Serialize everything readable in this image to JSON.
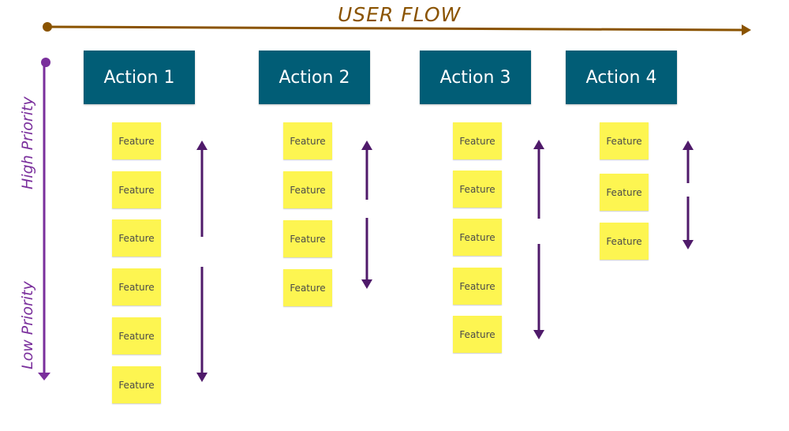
{
  "flow_axis": {
    "label": "USER FLOW",
    "color": "#8a5300"
  },
  "priority_axis": {
    "high_label": "High Priority",
    "low_label": "Low Priority",
    "color": "#7a2f9c"
  },
  "arrow_color": "#4f1a6a",
  "action_color": "#015d76",
  "note_color": "#fdf551",
  "actions": [
    {
      "label": "Action 1",
      "features": [
        "Feature",
        "Feature",
        "Feature",
        "Feature",
        "Feature",
        "Feature"
      ]
    },
    {
      "label": "Action 2",
      "features": [
        "Feature",
        "Feature",
        "Feature",
        "Feature"
      ]
    },
    {
      "label": "Action 3",
      "features": [
        "Feature",
        "Feature",
        "Feature",
        "Feature",
        "Feature"
      ]
    },
    {
      "label": "Action 4",
      "features": [
        "Feature",
        "Feature",
        "Feature"
      ]
    }
  ]
}
